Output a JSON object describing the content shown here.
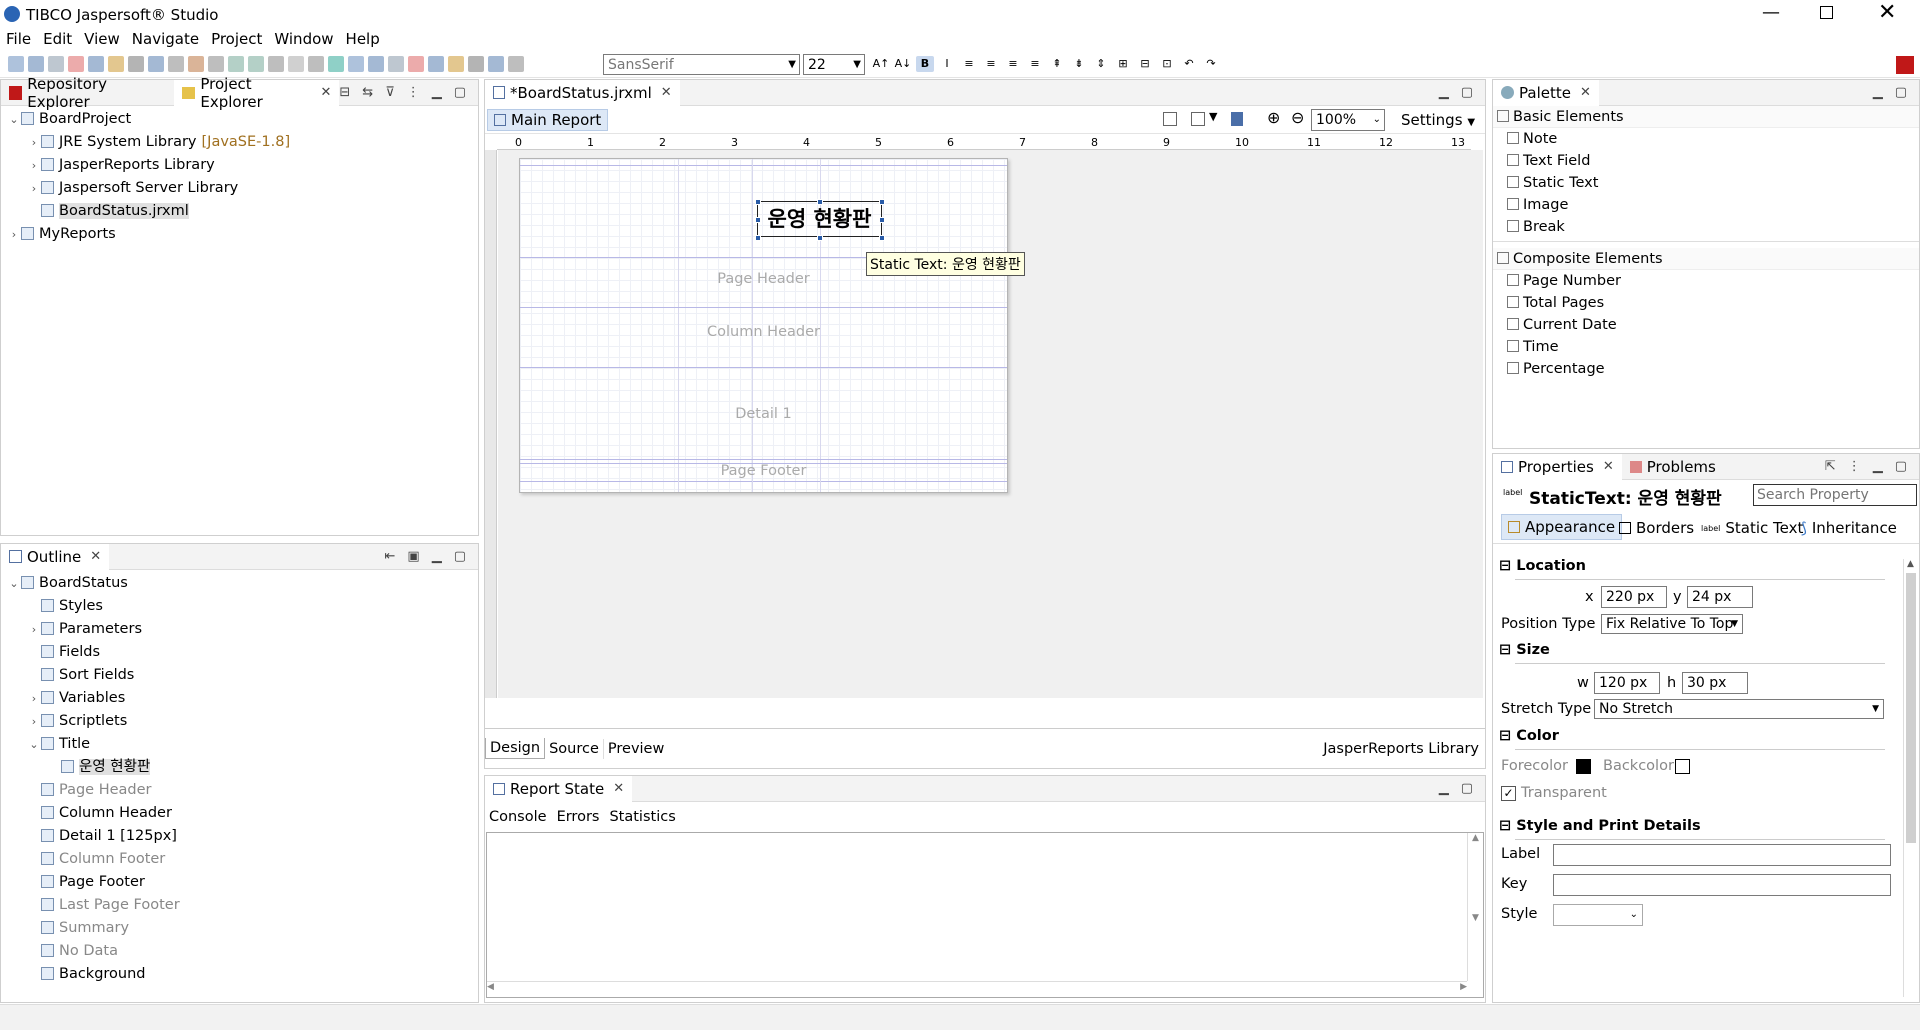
{
  "title": "TIBCO Jaspersoft® Studio",
  "menu": [
    "File",
    "Edit",
    "View",
    "Navigate",
    "Project",
    "Window",
    "Help"
  ],
  "toolbar": {
    "font": "SansSerif",
    "size": "22"
  },
  "explorer": {
    "tabs": [
      "Repository Explorer",
      "Project Explorer"
    ],
    "tree": [
      {
        "label": "BoardProject",
        "level": 0,
        "exp": "v"
      },
      {
        "label": "JRE System Library",
        "suffix": "[JavaSE-1.8]",
        "level": 1,
        "exp": ">"
      },
      {
        "label": "JasperReports Library",
        "level": 1,
        "exp": ">"
      },
      {
        "label": "Jaspersoft Server Library",
        "level": 1,
        "exp": ">"
      },
      {
        "label": "BoardStatus.jrxml",
        "level": 1,
        "exp": "",
        "sel": true
      },
      {
        "label": "MyReports",
        "level": 0,
        "exp": ">"
      }
    ]
  },
  "outline": {
    "tab": "Outline",
    "tree": [
      {
        "label": "BoardStatus",
        "level": 0,
        "exp": "v"
      },
      {
        "label": "Styles",
        "level": 1,
        "exp": ""
      },
      {
        "label": "Parameters",
        "level": 1,
        "exp": ">"
      },
      {
        "label": "Fields",
        "level": 1,
        "exp": ""
      },
      {
        "label": "Sort Fields",
        "level": 1,
        "exp": ""
      },
      {
        "label": "Variables",
        "level": 1,
        "exp": ">"
      },
      {
        "label": "Scriptlets",
        "level": 1,
        "exp": ">"
      },
      {
        "label": "Title",
        "level": 1,
        "exp": "v"
      },
      {
        "label": "운영 현황판",
        "level": 2,
        "exp": "",
        "sel": true
      },
      {
        "label": "Page Header",
        "level": 1,
        "exp": "",
        "grey": true
      },
      {
        "label": "Column Header",
        "level": 1,
        "exp": ""
      },
      {
        "label": "Detail 1 [125px]",
        "level": 1,
        "exp": ""
      },
      {
        "label": "Column Footer",
        "level": 1,
        "exp": "",
        "grey": true
      },
      {
        "label": "Page Footer",
        "level": 1,
        "exp": ""
      },
      {
        "label": "Last Page Footer",
        "level": 1,
        "exp": "",
        "grey": true
      },
      {
        "label": "Summary",
        "level": 1,
        "exp": "",
        "grey": true
      },
      {
        "label": "No Data",
        "level": 1,
        "exp": "",
        "grey": true
      },
      {
        "label": "Background",
        "level": 1,
        "exp": ""
      }
    ]
  },
  "editor": {
    "tab": "*BoardStatus.jrxml",
    "subtab": "Main Report",
    "zoom": "100%",
    "settings": "Settings",
    "ruler": [
      "0",
      "1",
      "2",
      "3",
      "4",
      "5",
      "6",
      "7",
      "8",
      "9",
      "10",
      "11",
      "12",
      "13"
    ],
    "title_text": "운영 현황판",
    "tooltip": "Static Text: 운영 현황판",
    "bands": [
      "Page Header",
      "Column Header",
      "Detail 1",
      "Page Footer"
    ],
    "bottom_tabs": [
      "Design",
      "Source",
      "Preview"
    ],
    "library": "JasperReports Library"
  },
  "reportstate": {
    "tab": "Report State",
    "subtabs": [
      "Console",
      "Errors",
      "Statistics"
    ]
  },
  "palette": {
    "tab": "Palette",
    "basic_title": "Basic Elements",
    "basic": [
      "Note",
      "Text Field",
      "Static Text",
      "Image",
      "Break"
    ],
    "composite_title": "Composite Elements",
    "composite": [
      "Page Number",
      "Total Pages",
      "Current Date",
      "Time",
      "Percentage"
    ]
  },
  "properties": {
    "tabs": [
      "Properties",
      "Problems"
    ],
    "heading": "StaticText: 운영 현황판",
    "search_placeholder": "Search Property",
    "subtabs": [
      "Appearance",
      "Borders",
      "Static Text",
      "Inheritance"
    ],
    "location": "Location",
    "x_label": "x",
    "x": "220 px",
    "y_label": "y",
    "y": "24 px",
    "pos_label": "Position Type",
    "pos": "Fix Relative To Top",
    "size": "Size",
    "w_label": "w",
    "w": "120 px",
    "h_label": "h",
    "h": "30 px",
    "stretch_label": "Stretch Type",
    "stretch": "No Stretch",
    "color": "Color",
    "forecolor": "Forecolor",
    "backcolor": "Backcolor",
    "transparent": "Transparent",
    "style_print": "Style and Print Details",
    "label": "Label",
    "key": "Key",
    "style": "Style"
  }
}
